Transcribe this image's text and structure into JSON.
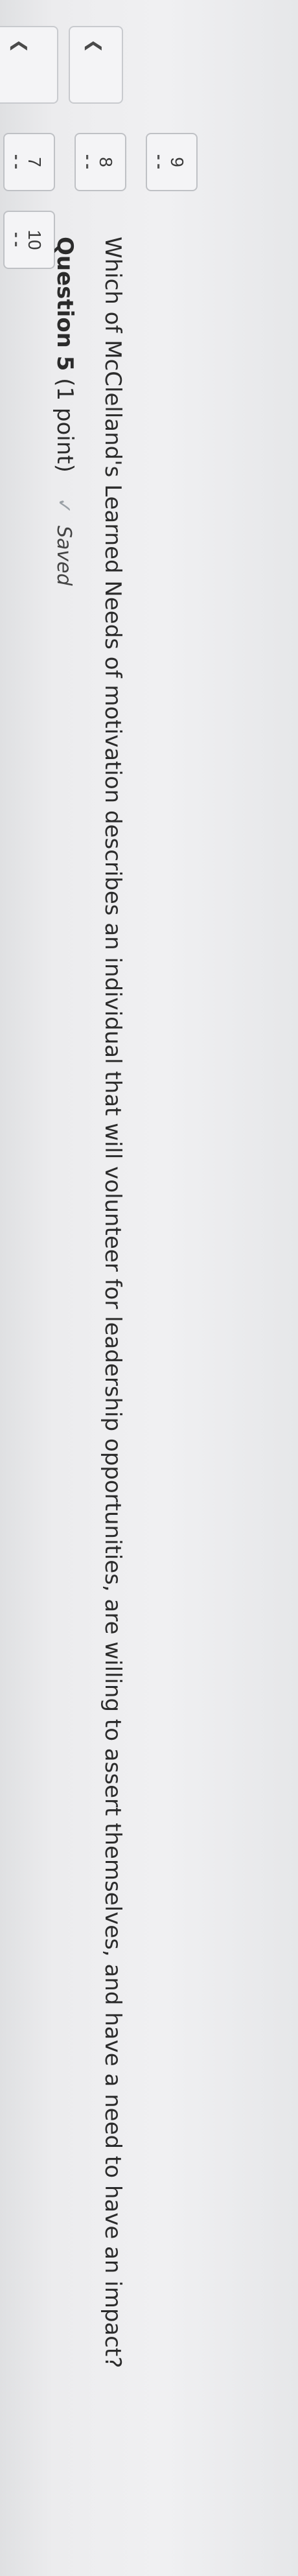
{
  "question_nav": {
    "items": [
      {
        "number": "7",
        "status": "--"
      },
      {
        "number": "8",
        "status": "--"
      },
      {
        "number": "9",
        "status": "--"
      },
      {
        "number": "10",
        "status": "--"
      }
    ]
  },
  "question": {
    "title": "Question 5",
    "points": "(1 point)",
    "saved_label": "Saved",
    "text": "Which of McClelland's Learned Needs of motivation describes an individual that will volunteer for leadership opportunities, are willing to assert themselves, and have a need to have an impact?"
  }
}
